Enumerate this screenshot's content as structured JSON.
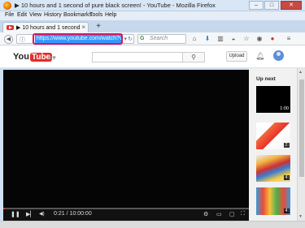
{
  "window": {
    "title": "▶ 10 hours and 1 second of pure black screen! - YouTube - Mozilla Firefox",
    "minimize": "–",
    "maximize": "□",
    "close": "✕"
  },
  "menu": [
    "File",
    "Edit",
    "View",
    "History",
    "Bookmarks",
    "Tools",
    "Help"
  ],
  "tab": {
    "label": "▶ 10 hours and 1 second o...",
    "close": "×",
    "new_tab": "+"
  },
  "navbar": {
    "url": "https://www.youtube.com/watch?v=X",
    "search_placeholder": "Search",
    "search_engine": "G"
  },
  "youtube": {
    "logo_you": "You",
    "logo_tube": "Tube",
    "upload_label": "Upload"
  },
  "player": {
    "current_time": "0:21",
    "duration": "10:00:00",
    "progress": 0.0006
  },
  "sidebar": {
    "heading": "Up next",
    "items": [
      {
        "duration": "1:00"
      },
      {
        "duration": "2:"
      },
      {
        "duration": "4:"
      },
      {
        "duration": "4:"
      }
    ]
  },
  "colors": {
    "accent": "#e52d27",
    "highlight": "#3399ff",
    "annotation": "#e0105e"
  }
}
